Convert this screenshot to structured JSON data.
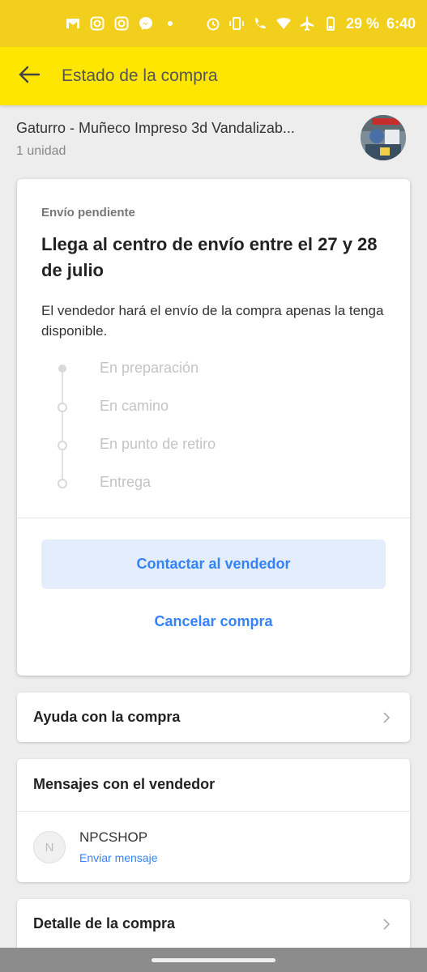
{
  "status_bar": {
    "battery": "29 %",
    "time": "6:40",
    "left_icons": [
      "gmail-icon",
      "instagram-icon",
      "instagram-icon",
      "messenger-icon",
      "dot-icon"
    ],
    "right_icons": [
      "alarm-icon",
      "vibrate-icon",
      "wifi-call-icon",
      "wifi-icon",
      "airplane-icon",
      "battery-icon"
    ]
  },
  "header": {
    "title": "Estado de la compra",
    "back_icon": "arrow-left-icon"
  },
  "product": {
    "name": "Gaturro - Muñeco Impreso 3d Vandalizab...",
    "quantity": "1 unidad"
  },
  "status_card": {
    "eyebrow": "Envío pendiente",
    "headline": "Llega al centro de envío entre el 27 y 28 de julio",
    "description": "El vendedor hará el envío de la compra apenas la tenga disponible.",
    "steps": [
      "En preparación",
      "En camino",
      "En punto de retiro",
      "Entrega"
    ],
    "contact_button": "Contactar al vendedor",
    "cancel_button": "Cancelar compra"
  },
  "help_row": {
    "label": "Ayuda con la compra"
  },
  "messages": {
    "title": "Mensajes con el vendedor",
    "avatar_initial": "N",
    "seller": "NPCSHOP",
    "send_link": "Enviar mensaje"
  },
  "detail_row": {
    "label": "Detalle de la compra"
  },
  "colors": {
    "status_bar": "#f2cf1d",
    "header": "#ffe600",
    "accent_blue": "#3483fa",
    "contact_button_bg": "#e3edfb"
  }
}
